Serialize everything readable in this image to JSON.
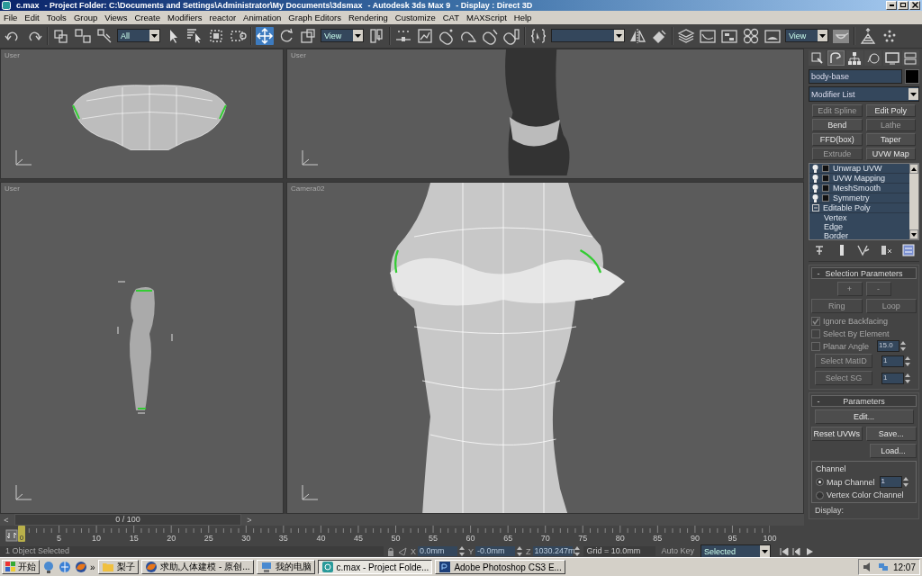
{
  "window": {
    "title_parts": [
      "c.max",
      "- Project Folder: C:\\Documents and Settings\\Administrator\\My Documents\\3dsmax",
      "- Autodesk 3ds Max 9",
      "- Display : Direct 3D"
    ]
  },
  "menu": [
    "File",
    "Edit",
    "Tools",
    "Group",
    "Views",
    "Create",
    "Modifiers",
    "reactor",
    "Animation",
    "Graph Editors",
    "Rendering",
    "Customize",
    "CAT",
    "MAXScript",
    "Help"
  ],
  "toolbar": [
    {
      "kind": "icon",
      "selected": false
    },
    {
      "kind": "icon",
      "selected": false
    },
    {
      "kind": "sep"
    },
    {
      "kind": "icon",
      "selected": false
    },
    {
      "kind": "icon",
      "selected": false
    },
    {
      "kind": "icon",
      "selected": false
    },
    {
      "kind": "dropdown",
      "value": "All"
    },
    {
      "kind": "icon",
      "selected": false
    },
    {
      "kind": "icon",
      "selected": false
    },
    {
      "kind": "icon",
      "selected": false
    },
    {
      "kind": "icon",
      "selected": false
    },
    {
      "kind": "sep"
    },
    {
      "kind": "icon",
      "selected": true
    },
    {
      "kind": "icon",
      "selected": false
    },
    {
      "kind": "icon",
      "selected": false
    },
    {
      "kind": "dropdown",
      "value": "View"
    },
    {
      "kind": "icon",
      "selected": false
    },
    {
      "kind": "sep"
    },
    {
      "kind": "icon",
      "selected": false
    },
    {
      "kind": "icon",
      "selected": false
    },
    {
      "kind": "icon",
      "selected": false
    },
    {
      "kind": "icon",
      "selected": false
    },
    {
      "kind": "icon",
      "selected": false
    },
    {
      "kind": "icon",
      "selected": false
    },
    {
      "kind": "sep"
    },
    {
      "kind": "icon",
      "selected": false
    },
    {
      "kind": "dropdown",
      "wide": true
    },
    {
      "kind": "icon",
      "selected": false
    },
    {
      "kind": "icon",
      "selected": false
    },
    {
      "kind": "sep"
    },
    {
      "kind": "icon",
      "selected": false
    },
    {
      "kind": "icon",
      "selected": false
    },
    {
      "kind": "icon",
      "selected": false
    },
    {
      "kind": "icon",
      "selected": false
    },
    {
      "kind": "icon",
      "selected": false
    },
    {
      "kind": "dropdown",
      "value": "View"
    },
    {
      "kind": "icon",
      "selected": false
    },
    {
      "kind": "sep"
    },
    {
      "kind": "icon",
      "selected": false
    },
    {
      "kind": "icon",
      "selected": false
    }
  ],
  "viewports": [
    {
      "label": "User"
    },
    {
      "label": "User"
    },
    {
      "label": "User"
    },
    {
      "label": "Camera02"
    }
  ],
  "time_slider": {
    "prev": "<",
    "frame": "0 / 100",
    "next": ">"
  },
  "trackbar": {
    "current": "0",
    "ticks": [
      "5",
      "10",
      "15",
      "20",
      "25",
      "30",
      "35",
      "40",
      "45",
      "50",
      "55",
      "60",
      "65",
      "70",
      "75",
      "80",
      "85",
      "90",
      "95",
      "100"
    ]
  },
  "command_panel": {
    "object_name": "body-base",
    "modifier_list": "Modifier List",
    "modifier_buttons": [
      {
        "label": "Edit Spline",
        "disabled": true
      },
      {
        "label": "Edit Poly",
        "disabled": false
      },
      {
        "label": "Bend",
        "disabled": false
      },
      {
        "label": "Lathe",
        "disabled": true
      },
      {
        "label": "FFD(box)",
        "disabled": false
      },
      {
        "label": "Taper",
        "disabled": false
      },
      {
        "label": "Extrude",
        "disabled": true
      },
      {
        "label": "UVW Map",
        "disabled": false
      }
    ],
    "stack": [
      {
        "label": "Unwrap UVW",
        "kind": "modifier"
      },
      {
        "label": "UVW Mapping",
        "kind": "modifier"
      },
      {
        "label": "MeshSmooth",
        "kind": "modifier"
      },
      {
        "label": "Symmetry",
        "kind": "modifier"
      },
      {
        "label": "Editable Poly",
        "kind": "base",
        "expanded": true,
        "children": [
          {
            "label": "Vertex"
          },
          {
            "label": "Edge"
          },
          {
            "label": "Border"
          }
        ]
      }
    ],
    "rollouts": [
      {
        "toggle": "-",
        "title": "Selection Parameters",
        "controls": [
          {
            "kind": "buttons",
            "items": [
              {
                "label": "+",
                "disabled": true
              },
              {
                "label": "-",
                "disabled": true
              }
            ]
          },
          {
            "kind": "buttons",
            "items": [
              {
                "label": "Ring",
                "disabled": true
              },
              {
                "label": "Loop",
                "disabled": true
              }
            ]
          },
          {
            "kind": "checkbox",
            "label": "Ignore Backfacing",
            "checked": true,
            "disabled": true
          },
          {
            "kind": "checkbox",
            "label": "Select By Element",
            "checked": false,
            "disabled": true
          },
          {
            "kind": "checkbox",
            "label": "Planar Angle",
            "checked": false,
            "disabled": true,
            "value": "15.0"
          },
          {
            "kind": "button_spinner",
            "label": "Select MatID",
            "value": "1",
            "disabled": true
          },
          {
            "kind": "button_spinner",
            "label": "Select SG",
            "value": "1",
            "disabled": true
          }
        ]
      },
      {
        "toggle": "-",
        "title": "Parameters",
        "controls": [
          {
            "kind": "buttons",
            "items": [
              {
                "label": "Edit...",
                "disabled": false
              }
            ]
          },
          {
            "kind": "buttons",
            "items": [
              {
                "label": "Reset UVWs",
                "disabled": false
              },
              {
                "label": "Save...",
                "disabled": false
              }
            ]
          },
          {
            "kind": "right_buttons",
            "items": [
              {
                "label": "Load...",
                "disabled": false
              }
            ]
          },
          {
            "kind": "group",
            "title": "Channel",
            "items": [
              {
                "label": "Map Channel",
                "selected": true,
                "value": "1"
              },
              {
                "label": "Vertex Color Channel",
                "selected": false
              }
            ]
          },
          {
            "kind": "label",
            "text": "Display:"
          }
        ]
      }
    ]
  },
  "status_bar": {
    "message": "1 Object Selected",
    "coords": [
      {
        "label": "X",
        "value": "0.0mm"
      },
      {
        "label": "Y",
        "value": "-0.0mm"
      },
      {
        "label": "Z",
        "value": "1030.247m"
      }
    ],
    "grid": "Grid = 10.0mm",
    "auto_key": "Auto Key",
    "key_filter": "Selected"
  },
  "taskbar": {
    "start": "开始",
    "more": "»",
    "tasks": [
      {
        "label": "梨子",
        "kind": "folder",
        "selected": false
      },
      {
        "label": "求助,人体建模 - 原创...",
        "kind": "browser",
        "selected": false
      },
      {
        "label": "我的电脑",
        "kind": "computer",
        "selected": false
      },
      {
        "label": "c.max    - Project Folde...",
        "kind": "max",
        "selected": true
      },
      {
        "label": "Adobe Photoshop CS3 E...",
        "kind": "ps",
        "selected": false
      }
    ],
    "clock": "12:07"
  }
}
